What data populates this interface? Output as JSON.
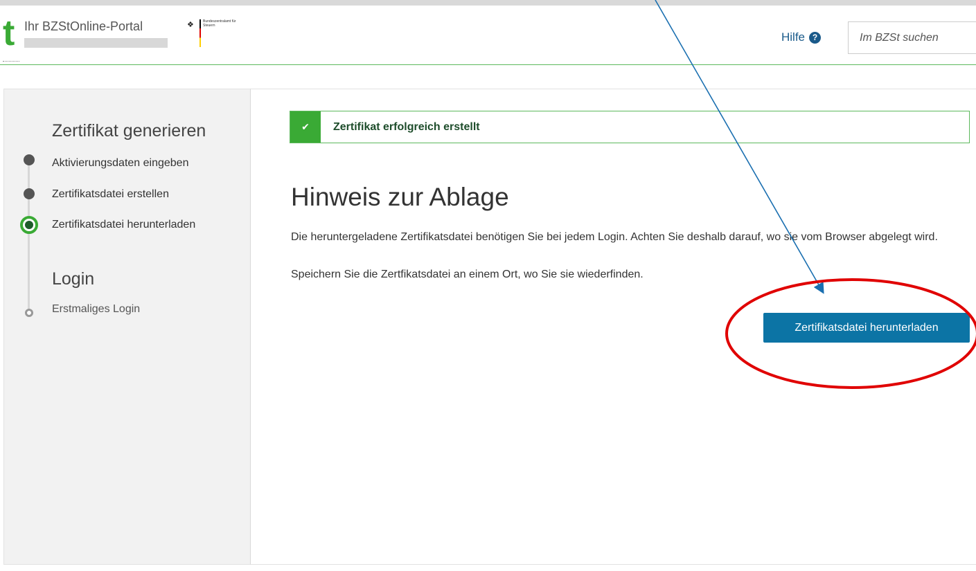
{
  "header": {
    "logo_letter": "t",
    "portal_name": "Ihr BZStOnline-Portal",
    "agency_name": "Bundeszentralamt für Steuern",
    "help_label": "Hilfe",
    "help_icon": "question-circle-icon",
    "search_placeholder": "Im BZSt suchen"
  },
  "sidebar": {
    "section1_title": "Zertifikat generieren",
    "steps": [
      {
        "label": "Aktivierungsdaten eingeben",
        "state": "done"
      },
      {
        "label": "Zertifikatsdatei erstellen",
        "state": "done"
      },
      {
        "label": "Zertifikatsdatei herunterladen",
        "state": "active"
      }
    ],
    "section2_title": "Login",
    "login_steps": [
      {
        "label": "Erstmaliges Login",
        "state": "future"
      }
    ]
  },
  "main": {
    "alert": {
      "icon": "check-icon",
      "text": "Zertifikat erfolgreich erstellt"
    },
    "title": "Hinweis zur Ablage",
    "paragraph1": "Die heruntergeladene Zertifikatsdatei benötigen Sie bei jedem Login. Achten Sie deshalb darauf, wo sie vom Browser abgelegt wird.",
    "paragraph2": "Speichern Sie die Zertfikatsdatei an einem Ort, wo Sie sie wiederfinden.",
    "download_button": "Zertifikatsdatei herunterladen"
  },
  "colors": {
    "brand_green": "#3aaa35",
    "button_blue": "#0c74a5",
    "annotation_arrow": "#1a6fb0",
    "annotation_ellipse": "#e00000"
  }
}
